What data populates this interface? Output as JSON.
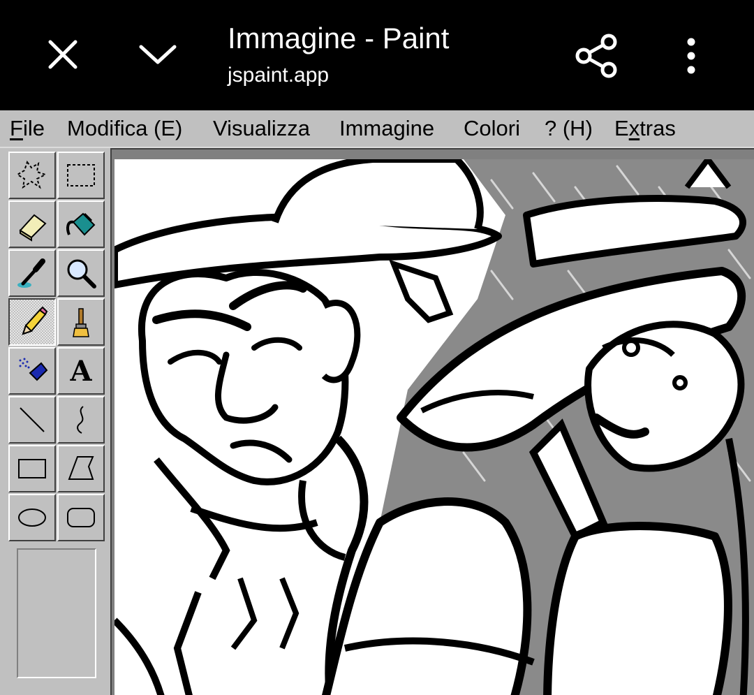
{
  "browser": {
    "title": "Immagine - Paint",
    "url": "jspaint.app",
    "icons": {
      "close": "close-icon",
      "minimize": "chevron-down-icon",
      "share": "share-icon",
      "more": "more-vert-icon"
    }
  },
  "menubar": {
    "file": {
      "access": "F",
      "rest": "ile"
    },
    "edit": "Modifica (E)",
    "view": "Visualizza",
    "image": "Immagine",
    "colors": "Colori",
    "help": "? (H)",
    "extras": {
      "pre": "E",
      "access": "x",
      "rest": "tras"
    }
  },
  "toolbox": {
    "tools": [
      {
        "name": "free-form-select",
        "icon": "free-select-icon"
      },
      {
        "name": "rect-select",
        "icon": "rect-select-icon"
      },
      {
        "name": "eraser",
        "icon": "eraser-icon"
      },
      {
        "name": "fill",
        "icon": "paint-bucket-icon"
      },
      {
        "name": "pick-color",
        "icon": "eyedropper-icon"
      },
      {
        "name": "magnifier",
        "icon": "magnifier-icon"
      },
      {
        "name": "pencil",
        "icon": "pencil-icon",
        "active": true
      },
      {
        "name": "brush",
        "icon": "brush-icon"
      },
      {
        "name": "airbrush",
        "icon": "airbrush-icon"
      },
      {
        "name": "text",
        "icon": "text-icon"
      },
      {
        "name": "line",
        "icon": "line-icon"
      },
      {
        "name": "curve",
        "icon": "curve-icon"
      },
      {
        "name": "rectangle",
        "icon": "rectangle-icon"
      },
      {
        "name": "polygon",
        "icon": "polygon-icon"
      },
      {
        "name": "ellipse",
        "icon": "ellipse-icon"
      },
      {
        "name": "rounded-rectangle",
        "icon": "rounded-rectangle-icon"
      }
    ],
    "text_tool_glyph": "A"
  },
  "colors": {
    "chrome": "#c0c0c0",
    "topbar": "#000000",
    "canvas_bg": "#808080"
  }
}
